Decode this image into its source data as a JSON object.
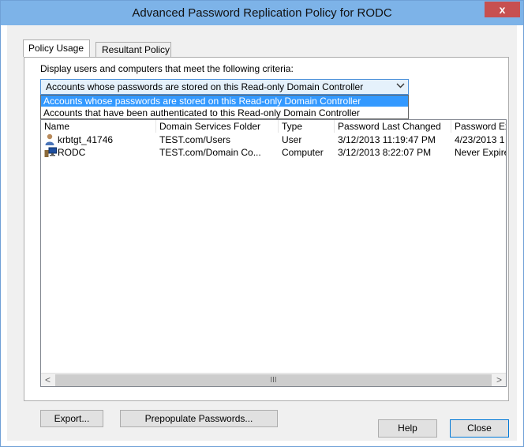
{
  "window": {
    "title": "Advanced Password Replication Policy for RODC",
    "close_glyph": "x"
  },
  "tabs": [
    {
      "label": "Policy Usage"
    },
    {
      "label": "Resultant Policy"
    }
  ],
  "criteria": {
    "label": "Display users and computers that meet the following criteria:",
    "selected": "Accounts whose passwords are stored on this Read-only Domain Controller",
    "options": [
      "Accounts whose passwords are stored on this Read-only Domain Controller",
      "Accounts that have been authenticated to this Read-only Domain Controller"
    ]
  },
  "table": {
    "columns": [
      "Name",
      "Domain Services Folder",
      "Type",
      "Password Last Changed",
      "Password Ex"
    ],
    "rows": [
      {
        "icon": "user-icon",
        "name": "krbtgt_41746",
        "folder": "TEST.com/Users",
        "type": "User",
        "changed": "3/12/2013 11:19:47 PM",
        "expires": "4/23/2013 1"
      },
      {
        "icon": "computer-icon",
        "name": "RODC",
        "folder": "TEST.com/Domain Co...",
        "type": "Computer",
        "changed": "3/12/2013 8:22:07 PM",
        "expires": "Never Expire"
      }
    ]
  },
  "scrollbar": {
    "left_glyph": "<",
    "right_glyph": ">",
    "grip_glyph": "III"
  },
  "buttons": {
    "export": "Export...",
    "prepopulate": "Prepopulate Passwords...",
    "help": "Help",
    "close": "Close"
  },
  "colors": {
    "titlebar": "#7db3e8",
    "close_button": "#c75050",
    "selection": "#3399ff"
  }
}
